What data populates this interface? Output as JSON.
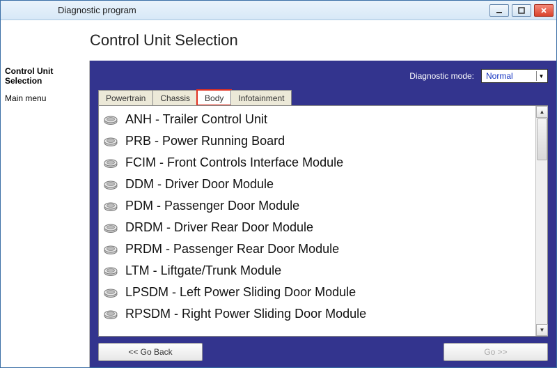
{
  "window": {
    "title": "Diagnostic program"
  },
  "header": {
    "title": "Control Unit Selection"
  },
  "sidebar": {
    "title": "Control Unit Selection",
    "items": [
      "Main menu"
    ]
  },
  "diagnostic": {
    "label": "Diagnostic mode:",
    "selected": "Normal"
  },
  "tabs": [
    {
      "label": "Powertrain",
      "active": false
    },
    {
      "label": "Chassis",
      "active": false
    },
    {
      "label": "Body",
      "active": true
    },
    {
      "label": "Infotainment",
      "active": false
    }
  ],
  "list": [
    "ANH - Trailer Control Unit",
    "PRB - Power Running Board",
    "FCIM - Front Controls Interface Module",
    "DDM - Driver Door Module",
    "PDM - Passenger Door Module",
    "DRDM - Driver Rear Door Module",
    "PRDM - Passenger Rear Door Module",
    "LTM - Liftgate/Trunk Module",
    "LPSDM - Left Power Sliding Door Module",
    "RPSDM - Right Power Sliding Door Module"
  ],
  "footer": {
    "back": "<< Go Back",
    "go": "Go >>"
  }
}
